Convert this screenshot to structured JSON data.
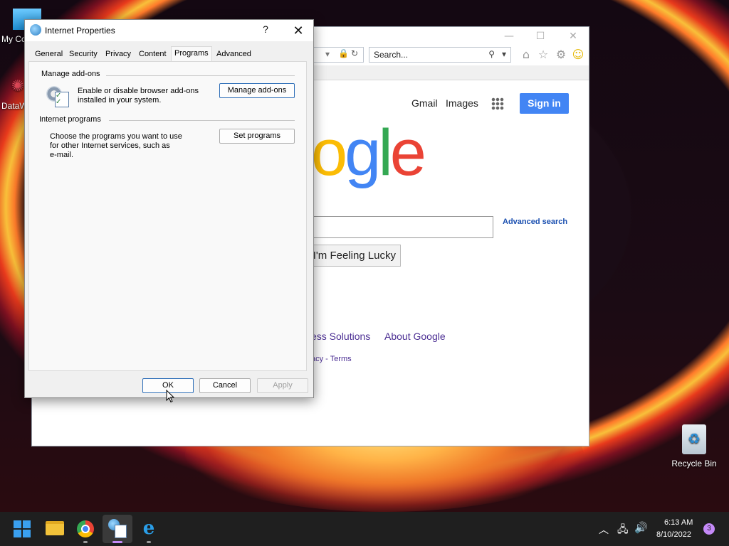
{
  "desktop": {
    "icons": [
      {
        "label": "My Co"
      },
      {
        "label": "DataW"
      },
      {
        "label": "Recycle Bin"
      }
    ]
  },
  "browser": {
    "search_placeholder": "Search...",
    "header_links": [
      "Gmail",
      "Images"
    ],
    "sign_in_label": "Sign in",
    "logo_fragment": [
      "o",
      "g",
      "l",
      "e"
    ],
    "lucky_label": "I'm Feeling Lucky",
    "advanced_search_label": "Advanced search",
    "footer_links": [
      "ess Solutions",
      "About Google"
    ],
    "footer_small": "acy - Terms"
  },
  "dialog": {
    "title": "Internet Properties",
    "help_label": "?",
    "tabs": [
      "General",
      "Security",
      "Privacy",
      "Content",
      "Programs",
      "Advanced"
    ],
    "active_tab": "Programs",
    "sections": {
      "addons": {
        "heading": "Manage add-ons",
        "description_lines": [
          "Enable or disable browser add-ons",
          "installed in your system."
        ],
        "button_label": "Manage add-ons"
      },
      "programs": {
        "heading": "Internet programs",
        "description_lines": [
          "Choose the programs you want to use",
          "for other Internet services, such as",
          "e-mail."
        ],
        "button_label": "Set programs"
      }
    },
    "buttons": {
      "ok": "OK",
      "cancel": "Cancel",
      "apply": "Apply"
    }
  },
  "taskbar": {
    "apps": [
      "start-icon",
      "file-explorer-icon",
      "chrome-icon",
      "internet-properties-icon",
      "internet-explorer-icon"
    ],
    "clock_time": "6:13 AM",
    "clock_date": "8/10/2022",
    "notification_count": "3"
  },
  "colors": {
    "google_blue": "#4285f4",
    "google_red": "#ea4335",
    "google_yellow": "#fbbc05",
    "google_green": "#34a853",
    "taskbar": "#1f1f1f",
    "badge": "#c58af9"
  }
}
